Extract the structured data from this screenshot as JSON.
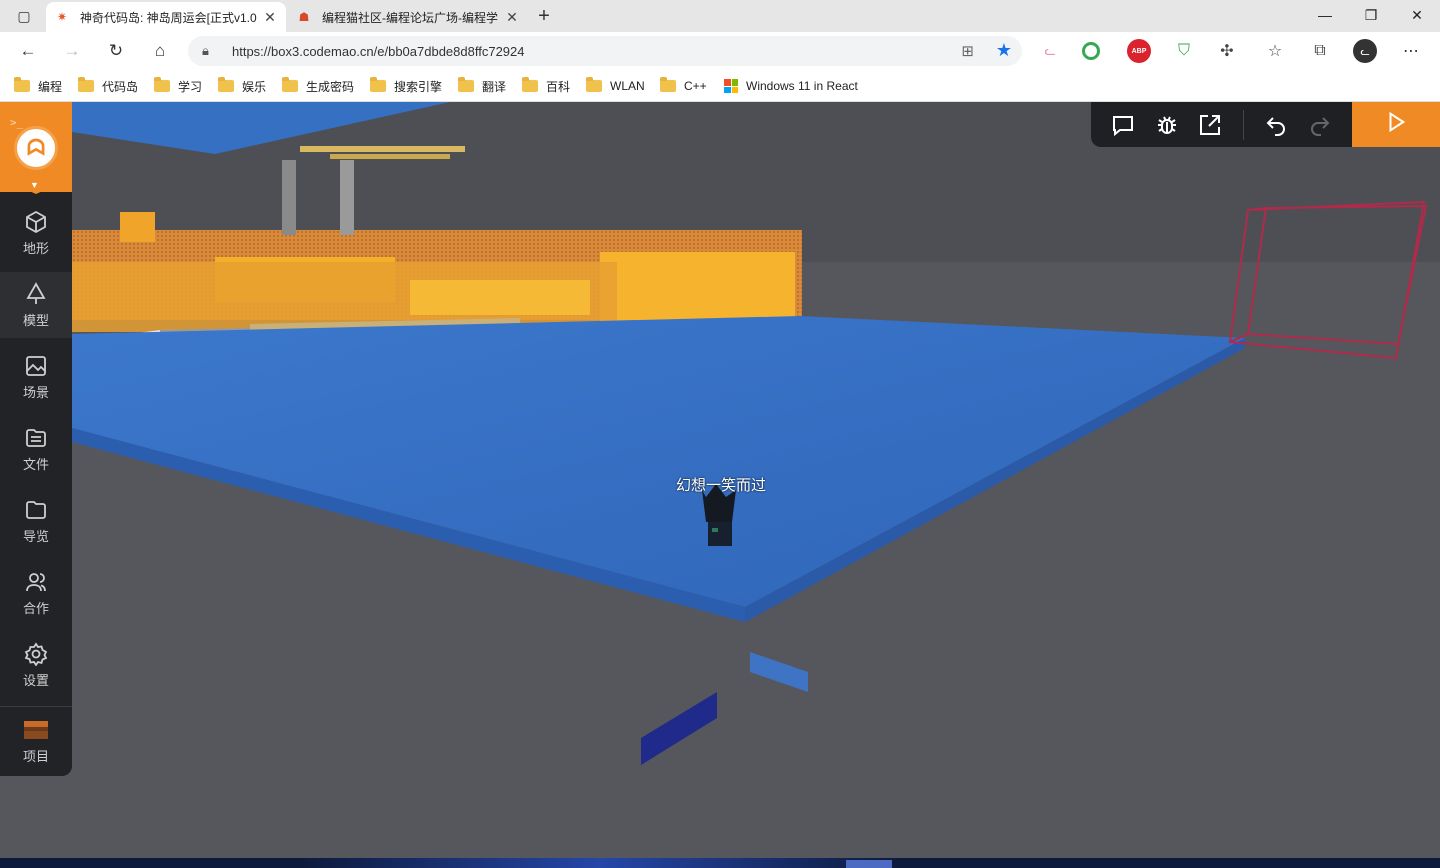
{
  "browser": {
    "tabs": [
      {
        "title": "神奇代码岛: 神岛周运会[正式v1.0",
        "active": true
      },
      {
        "title": "编程猫社区-编程论坛广场-编程学",
        "active": false
      }
    ],
    "url": "https://box3.codemao.cn/e/bb0a7dbde8d8ffc72924",
    "bookmarks": [
      "编程",
      "代码岛",
      "学习",
      "娱乐",
      "生成密码",
      "搜索引擎",
      "翻译",
      "百科",
      "WLAN",
      "C++",
      "Windows 11 in React"
    ]
  },
  "sidebar": {
    "items": [
      {
        "label": "地形",
        "icon": "cube-icon"
      },
      {
        "label": "模型",
        "icon": "tree-icon"
      },
      {
        "label": "场景",
        "icon": "image-icon"
      },
      {
        "label": "文件",
        "icon": "file-list-icon"
      },
      {
        "label": "导览",
        "icon": "folder-icon"
      },
      {
        "label": "合作",
        "icon": "users-icon"
      },
      {
        "label": "设置",
        "icon": "gear-icon"
      }
    ],
    "project_label": "项目"
  },
  "toolbar": {
    "buttons": [
      "chat-icon",
      "debug-bug-icon",
      "fullscreen-icon",
      "undo-icon",
      "redo-icon"
    ],
    "run": "play-icon"
  },
  "scene": {
    "player_name": "幻想一笑而过"
  },
  "colors": {
    "accent": "#f08a24",
    "sidebar_bg": "#222326",
    "ground": "#55575d",
    "water": "#3570c4"
  }
}
